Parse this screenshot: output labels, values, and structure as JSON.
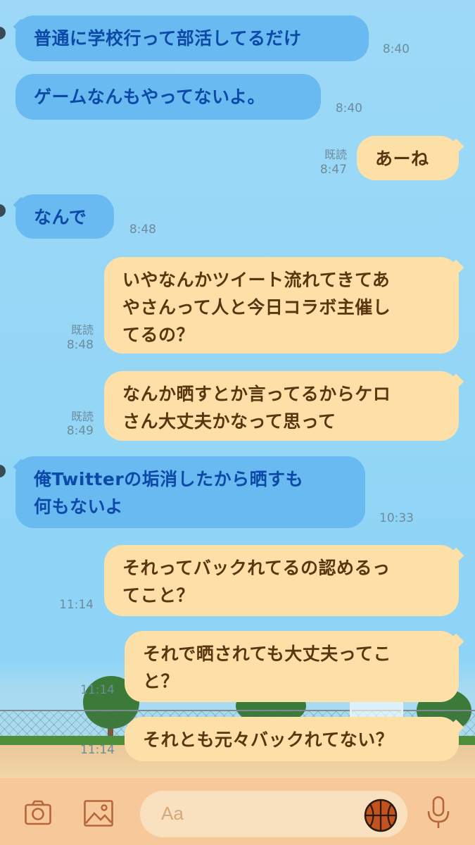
{
  "messages": [
    {
      "side": "in",
      "text": "普通に学校行って部活してるだけ",
      "time": "8:40"
    },
    {
      "side": "in",
      "text": "ゲームなんもやってないよ。",
      "time": "8:40"
    },
    {
      "side": "out",
      "text": "あーね",
      "time": "8:47",
      "read": "既読"
    },
    {
      "side": "in",
      "text": "なんで",
      "time": "8:48"
    },
    {
      "side": "out",
      "text": "いやなんかツイート流れてきてあ\nやさんって人と今日コラボ主催し\nてるの？",
      "time": "8:48",
      "read": "既読"
    },
    {
      "side": "out",
      "text": "なんか晒すとか言ってるからケロ\nさん大丈夫かなって思って",
      "time": "8:49",
      "read": "既読"
    },
    {
      "side": "in",
      "text": "俺Twitterの垢消したから晒すも\n何もないよ",
      "time": "10:33"
    },
    {
      "side": "out",
      "text": "それってバックれてるの認めるっ\nてこと？",
      "time": "11:14"
    },
    {
      "side": "out",
      "text": "それで晒されても大丈夫ってこ\nと？",
      "time": "11:14"
    },
    {
      "side": "out",
      "text": "それとも元々バックれてない？",
      "time": "11:14"
    }
  ],
  "input": {
    "placeholder": "Aa"
  },
  "icons": {
    "camera": "camera-icon",
    "image": "image-icon",
    "sticker": "basketball-sticker-icon",
    "mic": "microphone-icon"
  },
  "colors": {
    "incoming_bubble": "#68baf0",
    "outgoing_bubble": "#fde0a8",
    "background": "#9dd9f7",
    "input_bar": "#f7c99a"
  }
}
